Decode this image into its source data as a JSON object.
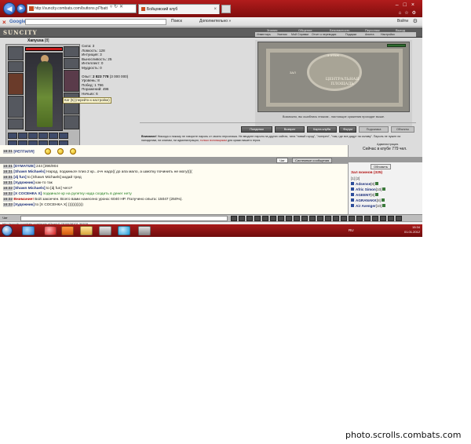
{
  "browser": {
    "address_text": "http://suncity.combats.com/buttons.pl?batt",
    "tab_title": "Бойцовский клуб",
    "toolbar": {
      "google_label": "Google",
      "search_label": "Поиск",
      "more_label": "Дополнительно »",
      "signin_label": "Войти"
    },
    "status_url": "http://suncity.combats.com/main.pl?pet=0.7518438101.30378"
  },
  "game": {
    "logo": "SUNCITY",
    "top_menu": [
      "Знания",
      "Общение",
      "Безопасность",
      "Персонаж",
      "Выход"
    ],
    "sub_menu": [
      "Инвентарь",
      "Умения",
      "Мой Справки",
      "Отчет о переводах",
      "Подарки",
      "Анкета",
      "Настройки"
    ],
    "character": {
      "name": "Xanyusa",
      "level": "[8]",
      "hp_fraction": 1.0
    },
    "tooltip": "Кат [5] (перейти к настройке)",
    "stats": [
      "Сила: 3",
      "Ловкость: 128",
      "Интуиция: 3",
      "Выносливость: 25",
      "Интеллект: 0",
      "Мудрость: 0"
    ],
    "exp": {
      "label": "Опыт:",
      "value": "2 823 778",
      "next": "(3 000 000)"
    },
    "stats2": [
      "Уровень: 8",
      "Побед: 1 796",
      "Поражений: 496",
      "Ничьих: 6"
    ],
    "map": {
      "text_main": "ЦЕНТРАЛЬНАЯ ПЛОЩАДЬ",
      "text_top": "3 ЭТАЖ",
      "text_left": "ЗАЛ",
      "caption": "Возможно, вы ошиблись этажом - настоящие сражения проходят выше."
    },
    "buttons": [
      "Поединки",
      "Возврат",
      "Карта клуба",
      "Форум",
      "Подсказка",
      "Объекты"
    ],
    "warning": {
      "bold": "Внимание!",
      "text": " Никогда и никому не говорите пароль от своего персонажа. Не вводите пароль на других сайтах, типа \"новый город\", \"лотерея\", \"там, где все дадут на халяву\". Пароль не нужен ни паладинам, ни кланам, ни администрации,",
      "red": " только взломщикам",
      "tail": " для кражи вашего героя."
    },
    "admin_label": "Администрация.",
    "online": "Сейчас в клубе 779 чел.",
    "logout_label": "обновить"
  },
  "chat": {
    "tabs": [
      "Чат",
      "Системные сообщения"
    ],
    "keyword": "rocket",
    "lines": [
      {
        "time": "16:31",
        "name": "[РЕПТИЛЯ]",
        "text": ""
      },
      {
        "time": "16:31",
        "name": "[DYMATIZE]",
        "text": " 244 [396/904"
      },
      {
        "time": "16:31",
        "name": "[Shawn Michaels]",
        "text": " Народ, подкиньте плиз 2 кр...очч надо(( до апа мало, а шмотку починить не могу(((("
      },
      {
        "time": "16:31",
        "name": "[dj fun]",
        "text": " to [Shawn Michaels] кидай тред"
      },
      {
        "time": "16:31",
        "name": "[Художник]",
        "text": " как-то так"
      },
      {
        "time": "16:32",
        "name": "[Shawn Michaels]",
        "text": " to [dj fun] чего?"
      },
      {
        "time": "16:32",
        "name": "[Х СОСЕНКА Х]",
        "text": " подкиньте кр на рулетку нада сходить в денег нету",
        "style": "g"
      },
      {
        "time": "16:32",
        "name": "Внимание!",
        "text": " Бой закончен. Всего вами нанесено урона: 6040 HP. Получено опыта: 15047 (250%).",
        "style": "r"
      },
      {
        "time": "16:33",
        "name": "[Художник]",
        "text": " to [Х СОСЕНКА Х] ))))))))))))"
      }
    ],
    "input_label": "Чат"
  },
  "sidebar": {
    "refresh_label": "Обновить",
    "room": "Зал воинов (325)",
    "pages": "[1] [2]",
    "users": [
      {
        "name": "Adsense",
        "level": "[8]"
      },
      {
        "name": "Afric Simon",
        "level": "[10]"
      },
      {
        "name": "AGEENT",
        "level": "[8]"
      },
      {
        "name": "AGRANAKK",
        "level": "[8]"
      },
      {
        "name": "Air Avenger",
        "level": "[10]"
      }
    ]
  },
  "taskbar": {
    "lang": "RU",
    "time": "15:34",
    "date": "01.01.2012"
  },
  "watermark": "photo.scrolls.combats.com"
}
